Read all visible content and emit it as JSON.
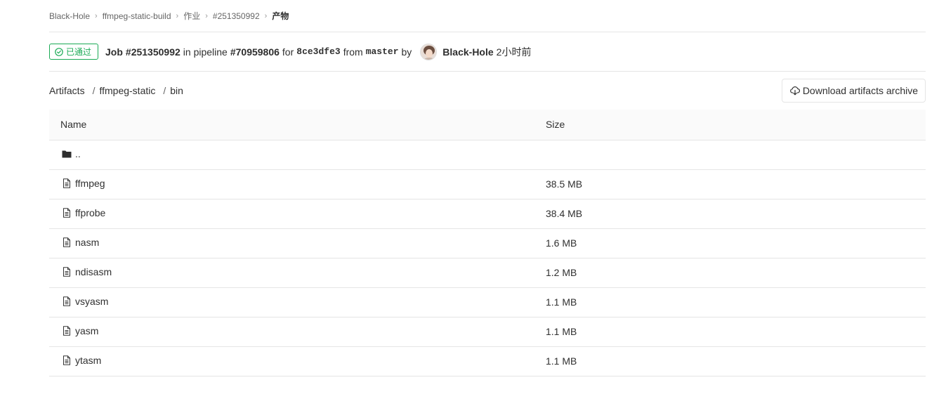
{
  "breadcrumb": {
    "items": [
      "Black-Hole",
      "ffmpeg-static-build",
      "作业",
      "#251350992"
    ],
    "current": "产物",
    "separator": "›"
  },
  "job": {
    "status": "已通过",
    "prefix": "Job",
    "job_id": "#251350992",
    "in_pipeline": "in pipeline",
    "pipeline_id": "#70959806",
    "for_text": "for",
    "commit": "8ce3dfe3",
    "from_text": "from",
    "branch": "master",
    "by_text": "by",
    "user": "Black-Hole",
    "time_ago": "2小时前",
    "status_color": "#1aaa55"
  },
  "path": {
    "segments": [
      "Artifacts",
      "ffmpeg-static",
      "bin"
    ],
    "separator": "/"
  },
  "download_button": {
    "label": "Download artifacts archive",
    "icon": "cloud-download-icon"
  },
  "table": {
    "headers": {
      "name": "Name",
      "size": "Size"
    },
    "parent_dir": "..",
    "files": [
      {
        "name": "ffmpeg",
        "size": "38.5 MB"
      },
      {
        "name": "ffprobe",
        "size": "38.4 MB"
      },
      {
        "name": "nasm",
        "size": "1.6 MB"
      },
      {
        "name": "ndisasm",
        "size": "1.2 MB"
      },
      {
        "name": "vsyasm",
        "size": "1.1 MB"
      },
      {
        "name": "yasm",
        "size": "1.1 MB"
      },
      {
        "name": "ytasm",
        "size": "1.1 MB"
      }
    ]
  }
}
